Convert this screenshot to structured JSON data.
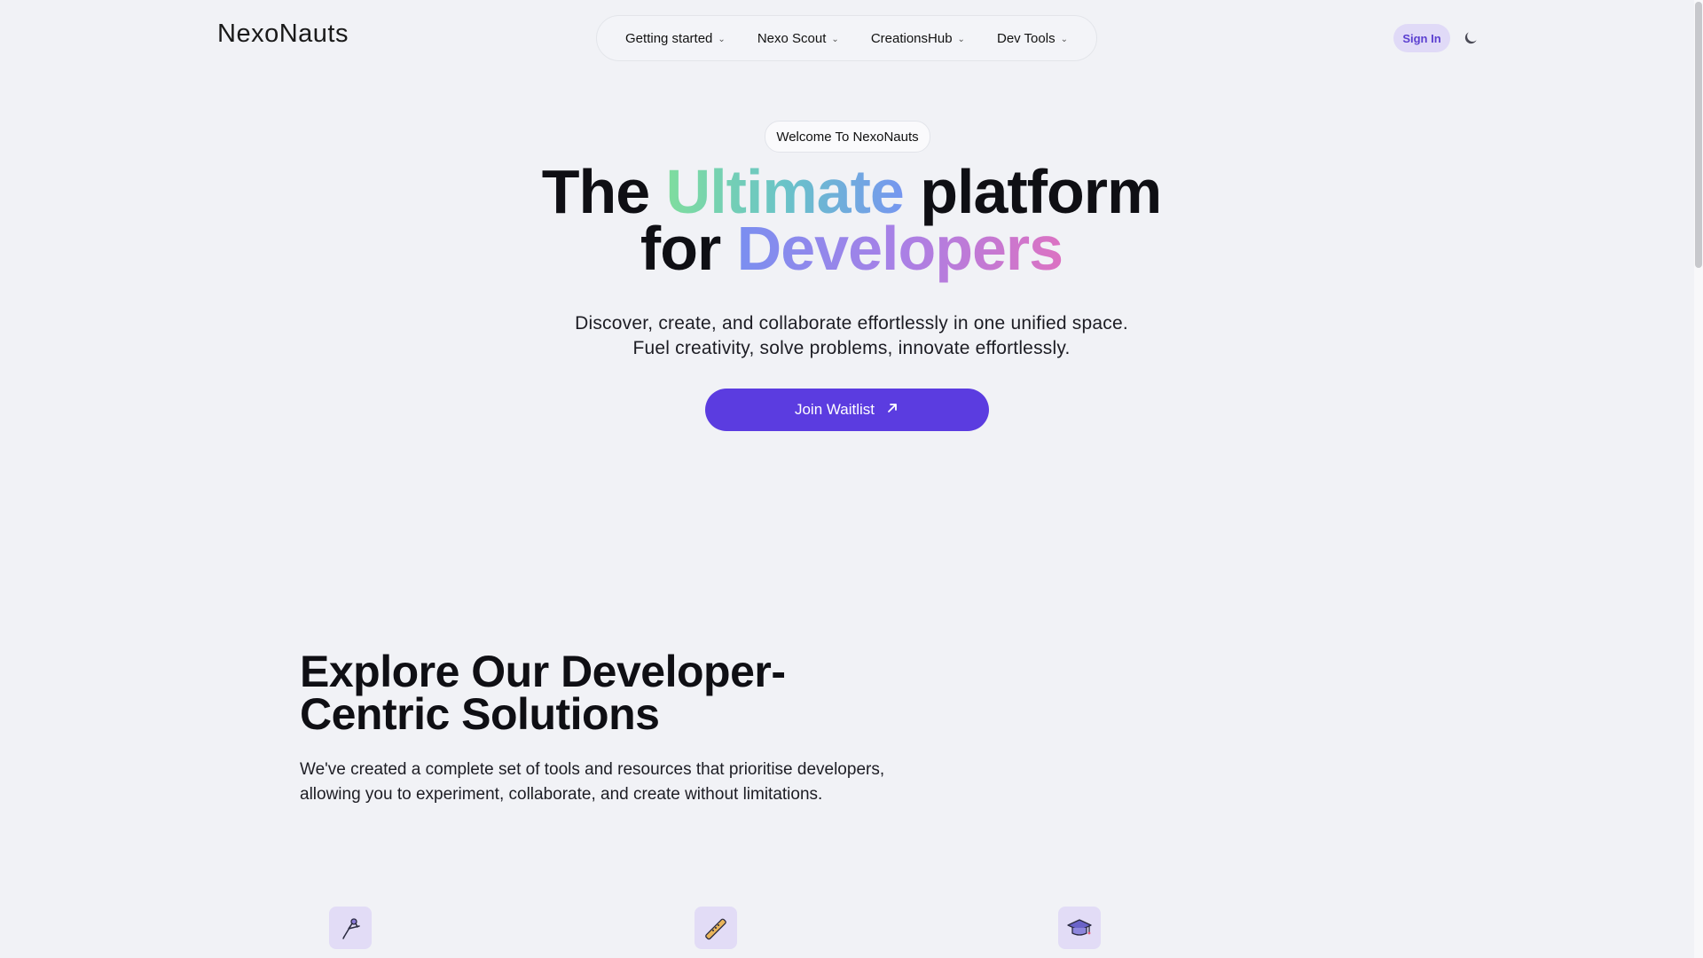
{
  "header": {
    "logo": "NexoNauts",
    "nav": [
      {
        "label": "Getting started"
      },
      {
        "label": "Nexo Scout"
      },
      {
        "label": "CreationsHub"
      },
      {
        "label": "Dev Tools"
      }
    ],
    "sign_in": "Sign In"
  },
  "hero": {
    "badge": "Welcome To NexoNauts",
    "title": {
      "part1": "The",
      "highlight1": "Ultimate",
      "part2": "platform",
      "part3": "for",
      "highlight2": "Developers"
    },
    "subtitle_line1": "Discover, create, and collaborate effortlessly in one unified space.",
    "subtitle_line2": "Fuel creativity, solve problems, innovate effortlessly.",
    "cta": "Join Waitlist"
  },
  "section": {
    "title_line1": "Explore Our Developer-",
    "title_line2": "Centric Solutions",
    "desc_line1": "We've created a complete set of tools and resources that prioritise developers,",
    "desc_line2": "allowing you to experiment, collaborate, and create without limitations.",
    "features": [
      {
        "icon": "compass-icon"
      },
      {
        "icon": "flute-icon"
      },
      {
        "icon": "graduation-cap-icon"
      }
    ]
  },
  "colors": {
    "accent": "#5b3ce0",
    "background": "#f1f2f6",
    "signin_bg": "#e0daf7",
    "signin_text": "#5b3fd0"
  }
}
